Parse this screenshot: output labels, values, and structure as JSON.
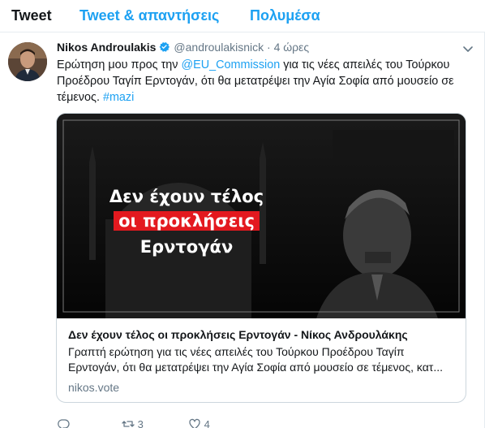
{
  "tabs": [
    {
      "label": "Tweet"
    },
    {
      "label": "Tweet & απαντήσεις"
    },
    {
      "label": "Πολυμέσα"
    }
  ],
  "tweet": {
    "name": "Nikos Androulakis",
    "handle": "@androulakisnick",
    "separator": "·",
    "time": "4 ώρες",
    "text_part1": "Ερώτηση μου προς την ",
    "mention": "@EU_Commission",
    "text_part2": " για τις νέες απειλές του Τούρκου Προέδρου Ταγίπ Ερντογάν, ότι θα μετατρέψει την Αγία Σοφία από μουσείο σε τέμενος. ",
    "hashtag": "#mazi"
  },
  "card": {
    "image_text_line1": "Δεν έχουν τέλος",
    "image_text_line2": "οι προκλήσεις",
    "image_text_line3": "Ερντογάν",
    "title": "Δεν έχουν τέλος οι προκλήσεις Ερντογάν - Νίκος Ανδρουλάκης",
    "description": "Γραπτή ερώτηση για τις νέες απειλές του Τούρκου Προέδρου Ταγίπ Ερντογάν, ότι θα μετατρέψει την Αγία Σοφία από μουσείο σε τέμενος, κατ...",
    "domain": "nikos.vote"
  },
  "actions": {
    "replies": "",
    "retweets": "3",
    "likes": "4"
  },
  "colors": {
    "accent": "#1da1f2",
    "secondary_text": "#657786",
    "highlight_red": "#e3191f"
  },
  "icons": [
    "verified-badge-icon",
    "chevron-down-icon",
    "reply-icon",
    "retweet-icon",
    "like-icon"
  ]
}
